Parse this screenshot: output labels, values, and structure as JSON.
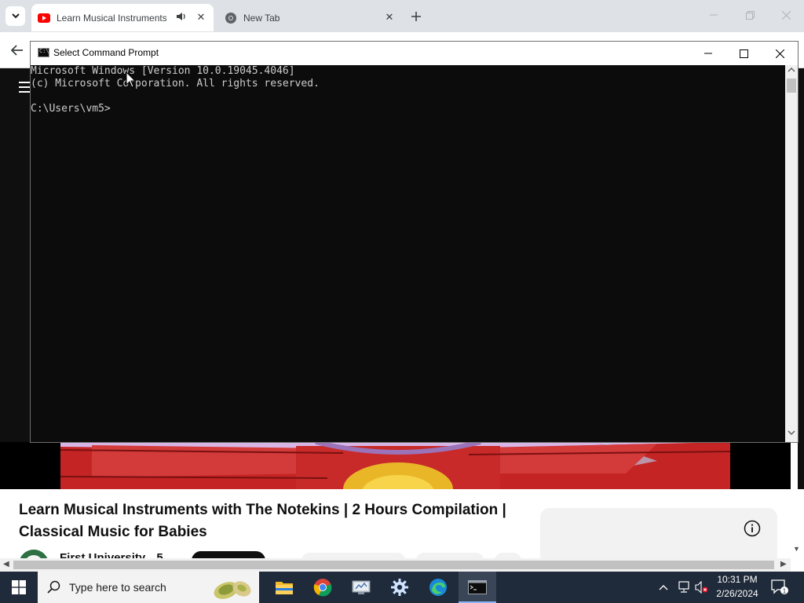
{
  "browser": {
    "tabs": [
      {
        "title": "Learn Musical Instruments with The Notekins",
        "active": true,
        "audio": true
      },
      {
        "title": "New Tab",
        "active": false
      }
    ]
  },
  "cmd": {
    "title": "Select Command Prompt",
    "lines": [
      "Microsoft Windows [Version 10.0.19045.4046]",
      "(c) Microsoft Corporation. All rights reserved.",
      "",
      "C:\\Users\\vm5>"
    ]
  },
  "youtube": {
    "video_title": "Learn Musical Instruments with The Notekins | 2 Hours Compilation | Classical Music for Babies",
    "channel_name": "First University",
    "channel_suffix": "5"
  },
  "taskbar": {
    "search_placeholder": "Type here to search",
    "time": "10:31 PM",
    "date": "2/26/2024",
    "apps": [
      "file-explorer",
      "chrome",
      "network-app",
      "settings",
      "edge",
      "command-prompt"
    ]
  },
  "colors": {
    "youtube_red": "#ff0000",
    "console_bg": "#0c0c0c",
    "console_text": "#cccccc",
    "taskbar_bg": "#1f2a3a"
  }
}
